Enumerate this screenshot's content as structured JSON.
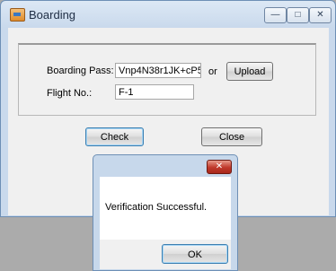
{
  "window": {
    "title": "Boarding",
    "minimize_glyph": "—",
    "maximize_glyph": "□",
    "close_glyph": "✕"
  },
  "form": {
    "boarding_pass_label": "Boarding Pass:",
    "boarding_pass_value": "Vnp4N38r1JK+cP5",
    "or_label": "or",
    "upload_label": "Upload",
    "flight_no_label": "Flight No.:",
    "flight_no_value": "F-1",
    "check_label": "Check",
    "close_label": "Close"
  },
  "dialog": {
    "message": "Verification Successful.",
    "ok_label": "OK",
    "close_glyph": "✕"
  },
  "icons": {
    "app": "boarding-app-icon"
  },
  "colors": {
    "title_bar": "#c9d9ec",
    "client": "#f0f0f0",
    "dialog_close": "#c0392b",
    "background": "#ababab"
  }
}
